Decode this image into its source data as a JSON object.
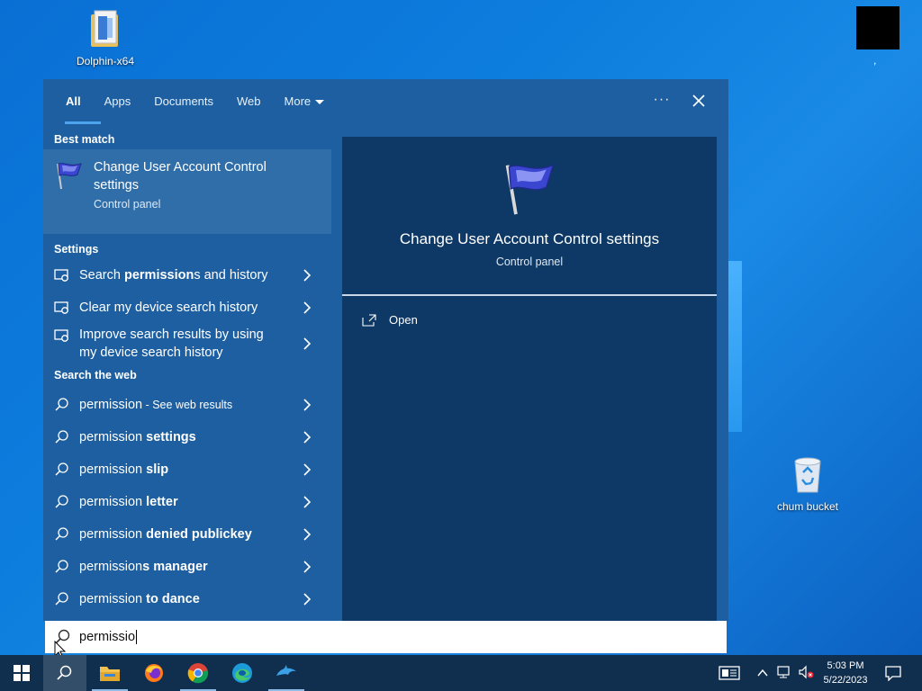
{
  "desktop": {
    "icons": [
      {
        "label": "Dolphin-x64"
      },
      {
        "label": "chum bucket"
      },
      {
        "label": ","
      }
    ]
  },
  "search": {
    "tabs": [
      {
        "label": "All"
      },
      {
        "label": "Apps"
      },
      {
        "label": "Documents"
      },
      {
        "label": "Web"
      },
      {
        "label": "More"
      }
    ],
    "ellipsis": "···",
    "best_match_heading": "Best match",
    "best_match": {
      "title": "Change User Account Control settings",
      "subtitle": "Control panel"
    },
    "settings_heading": "Settings",
    "settings_items": [
      {
        "pre": "Search ",
        "bold": "permission",
        "post": "s and history"
      },
      {
        "pre": "Clear my device search history",
        "bold": "",
        "post": ""
      },
      {
        "pre": "Improve search results by using my device search history",
        "bold": "",
        "post": ""
      }
    ],
    "web_heading": "Search the web",
    "web_items": [
      {
        "pre": "permission",
        "bold": "",
        "post": "",
        "small": " - See web results"
      },
      {
        "pre": "permission ",
        "bold": "settings",
        "post": "",
        "small": ""
      },
      {
        "pre": "permission ",
        "bold": "slip",
        "post": "",
        "small": ""
      },
      {
        "pre": "permission ",
        "bold": "letter",
        "post": "",
        "small": ""
      },
      {
        "pre": "permission ",
        "bold": "denied publickey",
        "post": "",
        "small": ""
      },
      {
        "pre": "permission",
        "bold": "s manager",
        "post": "",
        "small": ""
      },
      {
        "pre": "permission ",
        "bold": "to dance",
        "post": "",
        "small": ""
      }
    ],
    "detail": {
      "title": "Change User Account Control settings",
      "subtitle": "Control panel",
      "action": "Open"
    },
    "query": "permissio"
  },
  "taskbar": {
    "clock_time": "5:03 PM",
    "clock_date": "5/22/2023",
    "apps": [
      "start",
      "search",
      "file-explorer",
      "firefox",
      "chrome",
      "edge",
      "dolphin"
    ]
  },
  "colors": {
    "flyout_bg": "#1d5fa0",
    "detail_bg": "#0e3966",
    "taskbar_bg": "#102f4e"
  }
}
